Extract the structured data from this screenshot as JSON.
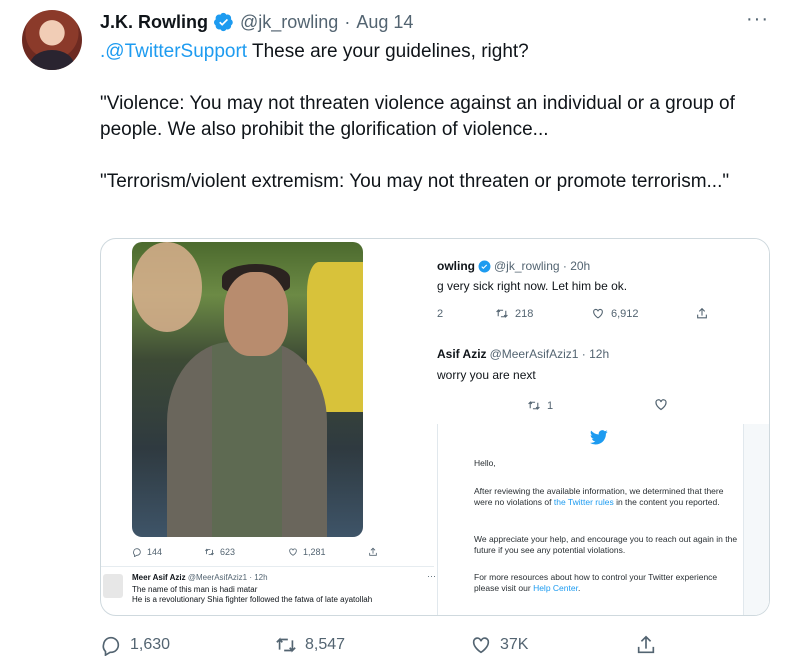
{
  "tweet": {
    "author_name": "J.K. Rowling",
    "handle": "@jk_rowling",
    "separator": "·",
    "time": "Aug 14",
    "more_label": "···",
    "mention": ".@TwitterSupport",
    "line1_rest": " These are your guidelines, right?",
    "para2": "\"Violence: You may not threaten violence against an individual or a group of people. We also prohibit the glorification of violence...",
    "para3": "\"Terrorism/violent extremism: You may not threaten or promote terrorism...\""
  },
  "left_screenshot": {
    "actions": [
      "144",
      "623",
      "1,281"
    ],
    "reply": {
      "name": "Meer Asif Aziz",
      "meta": "@MeerAsifAziz1 · 12h",
      "more": "···",
      "line1": "The name of this man is hadi matar",
      "line2": "He is a revolutionary Shia fighter followed the fatwa of late ayatollah"
    }
  },
  "right_screenshot": {
    "tweet1": {
      "name": "owling",
      "meta": "@jk_rowling · 20h",
      "text": "g very sick right now. Let him be ok.",
      "replies": "2",
      "retweets": "218",
      "likes": "6,912"
    },
    "tweet2": {
      "name": "Asif Aziz",
      "meta": "@MeerAsifAziz1 · 12h",
      "text": "worry you are next",
      "retweets": "1"
    },
    "email": {
      "greeting": "Hello,",
      "p1_a": "After reviewing the available information, we determined that there were no violations of ",
      "p1_link": "the Twitter rules",
      "p1_b": " in the content you reported.",
      "p2": "We appreciate your help, and encourage you to reach out again in the future if you see any potential violations.",
      "p3_a": "For more resources about how to control your Twitter experience please visit our ",
      "p3_link": "Help Center",
      "p3_b": "."
    }
  },
  "actions": {
    "replies": "1,630",
    "retweets": "8,547",
    "likes": "37K"
  },
  "colors": {
    "accent": "#1d9bf0",
    "text": "#0f1419",
    "secondary": "#536471",
    "border": "#cfd9de"
  }
}
